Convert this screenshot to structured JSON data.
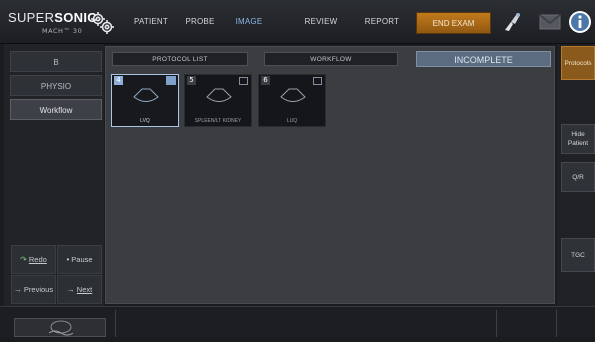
{
  "brand": {
    "name_part1": "SUPER",
    "name_part2": "SONIC",
    "model": "MACH™ 30"
  },
  "nav": {
    "tabs": [
      {
        "label": "PATIENT"
      },
      {
        "label": "PROBE"
      },
      {
        "label": "IMAGE",
        "active": true
      },
      {
        "label": "REVIEW"
      },
      {
        "label": "REPORT"
      }
    ],
    "end_exam": "END EXAM"
  },
  "left": {
    "modes": [
      {
        "label": "B"
      },
      {
        "label": "PHYSIO"
      },
      {
        "label": "Workflow",
        "active": true
      }
    ],
    "redo": "Redo",
    "pause": "Pause",
    "previous": "Previous",
    "next": "Next"
  },
  "main": {
    "protocol_list": "PROTOCOL LIST",
    "workflow": "WORKFLOW",
    "status": "INCOMPLETE",
    "thumbs": [
      {
        "num": "4",
        "caption": "LVQ",
        "selected": true
      },
      {
        "num": "5",
        "caption": "SPLEEN/LT KIDNEY",
        "selected": false
      },
      {
        "num": "6",
        "caption": "LUQ",
        "selected": false
      }
    ]
  },
  "right": {
    "protocols": "Protocols",
    "hide_patient_1": "Hide",
    "hide_patient_2": "Patient",
    "qr": "Q/R",
    "tgc": "TGC"
  },
  "colors": {
    "accent": "#8db7e8",
    "end_exam": "#b57218",
    "status_bg": "#5b6b80",
    "protocols_active": "#8a5a1d"
  },
  "icons": [
    "gear-icon",
    "probe-icon",
    "mail-icon",
    "info-icon",
    "redo-icon",
    "pause-icon",
    "previous-icon",
    "next-icon"
  ]
}
